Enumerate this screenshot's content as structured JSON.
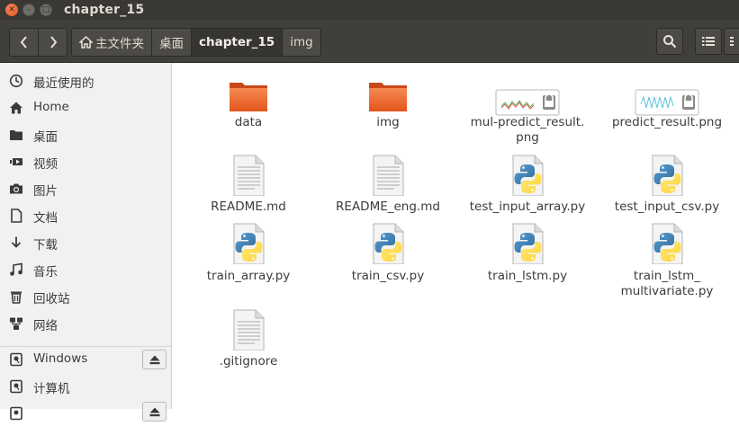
{
  "window": {
    "title": "chapter_15",
    "close_glyph": "✕",
    "min_glyph": "–",
    "max_glyph": "□"
  },
  "nav": {
    "back_icon": "chevron-left-icon",
    "forward_icon": "chevron-right-icon"
  },
  "breadcrumbs": [
    {
      "label": "主文件夹",
      "icon": "home-icon"
    },
    {
      "label": "桌面"
    },
    {
      "label": "chapter_15",
      "active": true
    },
    {
      "label": "img"
    }
  ],
  "toolbar": {
    "search_icon": "search-icon",
    "view_icon": "list-view-icon",
    "menu_icon": "menu-icon"
  },
  "sidebar": {
    "items": [
      {
        "label": "最近使用的",
        "icon": "clock-icon"
      },
      {
        "label": "Home",
        "icon": "home-icon"
      },
      {
        "label": "桌面",
        "icon": "folder-icon"
      },
      {
        "label": "视频",
        "icon": "video-icon"
      },
      {
        "label": "图片",
        "icon": "camera-icon"
      },
      {
        "label": "文档",
        "icon": "document-icon"
      },
      {
        "label": "下载",
        "icon": "download-icon"
      },
      {
        "label": "音乐",
        "icon": "music-icon"
      },
      {
        "label": "回收站",
        "icon": "trash-icon"
      },
      {
        "label": "网络",
        "icon": "network-icon"
      }
    ],
    "devices": [
      {
        "label": "Windows",
        "icon": "drive-icon",
        "eject": true
      },
      {
        "label": "计算机",
        "icon": "drive-icon"
      },
      {
        "label": "",
        "icon": "drive-icon",
        "eject": true
      }
    ]
  },
  "files": [
    {
      "name": "data",
      "type": "folder"
    },
    {
      "name": "img",
      "type": "folder"
    },
    {
      "name": "mul-predict_result.",
      "name2": "png",
      "type": "image"
    },
    {
      "name": "predict_result.png",
      "type": "image"
    },
    {
      "name": "README.md",
      "type": "text"
    },
    {
      "name": "README_eng.md",
      "type": "text"
    },
    {
      "name": "test_input_array.py",
      "type": "python"
    },
    {
      "name": "test_input_csv.py",
      "type": "python"
    },
    {
      "name": "train_array.py",
      "type": "python"
    },
    {
      "name": "train_csv.py",
      "type": "python"
    },
    {
      "name": "train_lstm.py",
      "type": "python"
    },
    {
      "name": "train_lstm_",
      "name2": "multivariate.py",
      "type": "python"
    },
    {
      "name": ".gitignore",
      "type": "text"
    }
  ],
  "colors": {
    "titlebar": "#393834",
    "header": "#413f3b",
    "sidebar": "#f1f1f1",
    "folder": "#e9652e",
    "close_button": "#e2531e"
  }
}
